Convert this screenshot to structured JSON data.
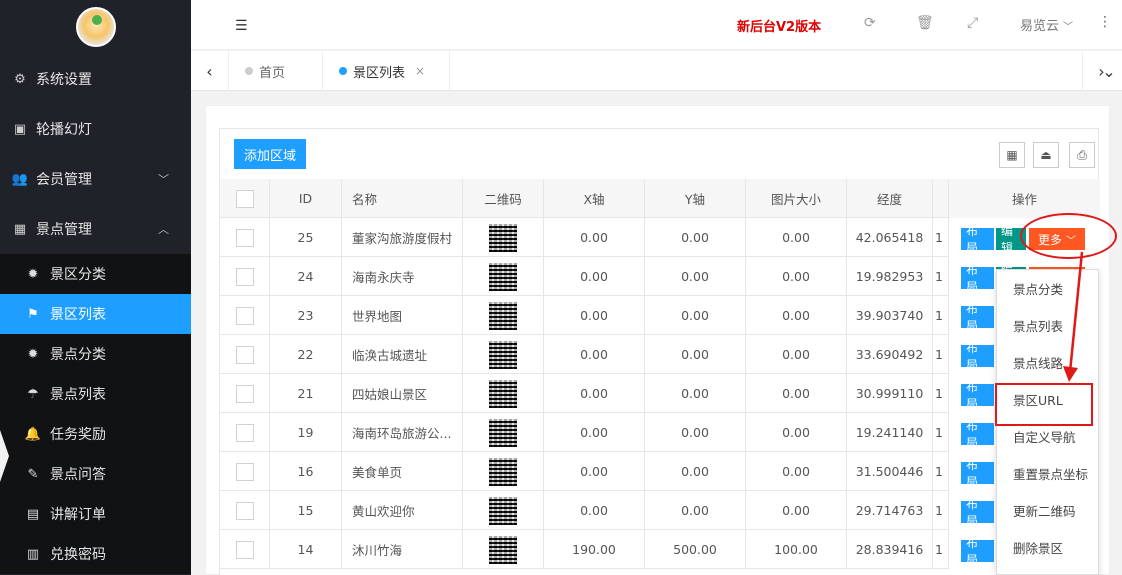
{
  "sidebar": {
    "menu": [
      {
        "icon": "gears-icon",
        "glyph": "⚙",
        "label": "系统设置"
      },
      {
        "icon": "image-icon",
        "glyph": "▣",
        "label": "轮播幻灯"
      },
      {
        "icon": "users-icon",
        "glyph": "👥",
        "label": "会员管理",
        "chevron": "﹀"
      },
      {
        "icon": "grid-icon",
        "glyph": "▦",
        "label": "景点管理",
        "chevron": "︿"
      }
    ],
    "submenu": [
      {
        "icon": "gear-icon",
        "glyph": "✹",
        "label": "景区分类"
      },
      {
        "icon": "flag-icon",
        "glyph": "⚑",
        "label": "景区列表",
        "active": true
      },
      {
        "icon": "gear-icon",
        "glyph": "✹",
        "label": "景点分类"
      },
      {
        "icon": "umbrella-icon",
        "glyph": "☂",
        "label": "景点列表"
      },
      {
        "icon": "bell-icon",
        "glyph": "🔔",
        "label": "任务奖励"
      },
      {
        "icon": "edit-icon",
        "glyph": "✎",
        "label": "景点问答"
      },
      {
        "icon": "audio-icon",
        "glyph": "▤",
        "label": "讲解订单"
      },
      {
        "icon": "barcode-icon",
        "glyph": "▥",
        "label": "兑换密码"
      }
    ]
  },
  "header": {
    "version": "新后台V2版本",
    "user": "易览云",
    "icons": {
      "menu": "☰",
      "refresh": "⟳",
      "trash": "🗑",
      "fullscreen": "⤢",
      "more": "⋮",
      "dropdown": "﹀"
    }
  },
  "tabs": {
    "prev": "‹",
    "next": "›",
    "expand": "⌄",
    "items": [
      {
        "label": "首页",
        "active": false
      },
      {
        "label": "景区列表",
        "active": true,
        "close": "×"
      }
    ]
  },
  "toolbar": {
    "add_label": "添加区域",
    "icons": {
      "columns": "▦",
      "export": "⏏",
      "print": "⎙"
    }
  },
  "table": {
    "headers": [
      "ID",
      "名称",
      "二维码",
      "X轴",
      "Y轴",
      "图片大小",
      "经度",
      "操作"
    ],
    "rows": [
      {
        "id": "25",
        "name": "董家沟旅游度假村",
        "x": "0.00",
        "y": "0.00",
        "size": "0.00",
        "lng": "42.065418",
        "extra": "1"
      },
      {
        "id": "24",
        "name": "海南永庆寺",
        "x": "0.00",
        "y": "0.00",
        "size": "0.00",
        "lng": "19.982953",
        "extra": "1"
      },
      {
        "id": "23",
        "name": "世界地图",
        "x": "0.00",
        "y": "0.00",
        "size": "0.00",
        "lng": "39.903740",
        "extra": "1"
      },
      {
        "id": "22",
        "name": "临涣古城遗址",
        "x": "0.00",
        "y": "0.00",
        "size": "0.00",
        "lng": "33.690492",
        "extra": "1"
      },
      {
        "id": "21",
        "name": "四姑娘山景区",
        "x": "0.00",
        "y": "0.00",
        "size": "0.00",
        "lng": "30.999110",
        "extra": "1"
      },
      {
        "id": "19",
        "name": "海南环岛旅游公...",
        "x": "0.00",
        "y": "0.00",
        "size": "0.00",
        "lng": "19.241140",
        "extra": "1"
      },
      {
        "id": "16",
        "name": "美食单页",
        "x": "0.00",
        "y": "0.00",
        "size": "0.00",
        "lng": "31.500446",
        "extra": "1"
      },
      {
        "id": "15",
        "name": "黄山欢迎你",
        "x": "0.00",
        "y": "0.00",
        "size": "0.00",
        "lng": "29.714763",
        "extra": "1"
      },
      {
        "id": "14",
        "name": "沐川竹海",
        "x": "190.00",
        "y": "500.00",
        "size": "100.00",
        "lng": "28.839416",
        "extra": "1"
      }
    ],
    "actions": {
      "layout": "布局",
      "edit": "编辑",
      "more": "更多",
      "more_chevron": "﹀"
    }
  },
  "dropdown": {
    "items": [
      "景点分类",
      "景点列表",
      "景点线路",
      "景区URL",
      "自定义导航",
      "重置景点坐标",
      "更新二维码",
      "删除景区"
    ]
  },
  "colors": {
    "primary": "#1e9fff",
    "green": "#009688",
    "orange": "#ff5722",
    "sidebar": "#20222a",
    "annotation": "#e01818",
    "version": "#e00000"
  }
}
